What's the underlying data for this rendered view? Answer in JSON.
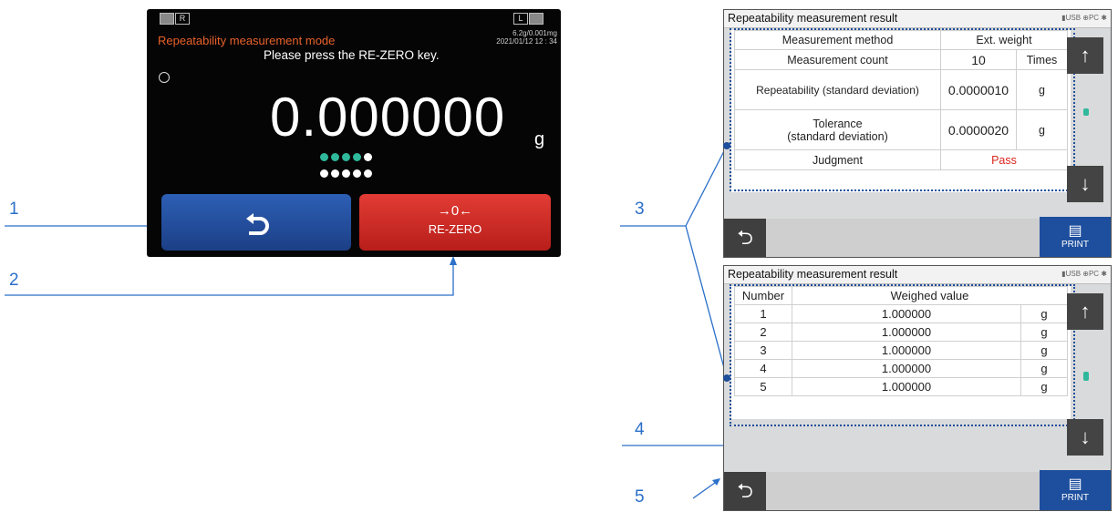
{
  "callouts": [
    "1",
    "2",
    "3",
    "4",
    "5"
  ],
  "left_screen": {
    "mode_title": "Repeatability measurement mode",
    "prompt": "Please press the RE-ZERO key.",
    "range": "6.2g/0.001mg",
    "datetime": "2021/01/12   12 : 34",
    "indicator_r": "R",
    "indicator_l": "L",
    "value": "0.000000",
    "unit": "g",
    "dot_rows": [
      [
        "#2fb89b",
        "#2fb89b",
        "#2fb89b",
        "#2fb89b",
        "#ffffff"
      ],
      [
        "#ffffff",
        "#ffffff",
        "#ffffff",
        "#ffffff",
        "#ffffff"
      ]
    ],
    "back_icon": "return-arrow-icon",
    "rezero_symbol": "→0←",
    "rezero_label": "RE-ZERO",
    "colors": {
      "mode_title": "#e8612a",
      "back_button": "#2d5fb5",
      "rezero_button": "#d8302a"
    }
  },
  "result_screen_1": {
    "title": "Repeatability measurement result",
    "status_icons": "▮USB  ⊕PC  ✱",
    "rows": [
      {
        "label": "Measurement method",
        "value": "Ext. weight",
        "unit": ""
      },
      {
        "label": "Measurement count",
        "value": "10",
        "unit": "Times"
      },
      {
        "label": "Repeatability (standard deviation)",
        "value": "0.0000010",
        "unit": "g"
      },
      {
        "label": "Tolerance\n(standard deviation)",
        "value": "0.0000020",
        "unit": "g"
      },
      {
        "label": "Judgment",
        "value": "Pass",
        "unit": ""
      }
    ],
    "print_label": "PRINT"
  },
  "result_screen_2": {
    "title": "Repeatability measurement result",
    "status_icons": "▮USB  ⊕PC  ✱",
    "header_number": "Number",
    "header_value": "Weighed value",
    "rows": [
      {
        "n": "1",
        "v": "1.000000",
        "u": "g"
      },
      {
        "n": "2",
        "v": "1.000000",
        "u": "g"
      },
      {
        "n": "3",
        "v": "1.000000",
        "u": "g"
      },
      {
        "n": "4",
        "v": "1.000000",
        "u": "g"
      },
      {
        "n": "5",
        "v": "1.000000",
        "u": "g"
      }
    ],
    "print_label": "PRINT"
  }
}
